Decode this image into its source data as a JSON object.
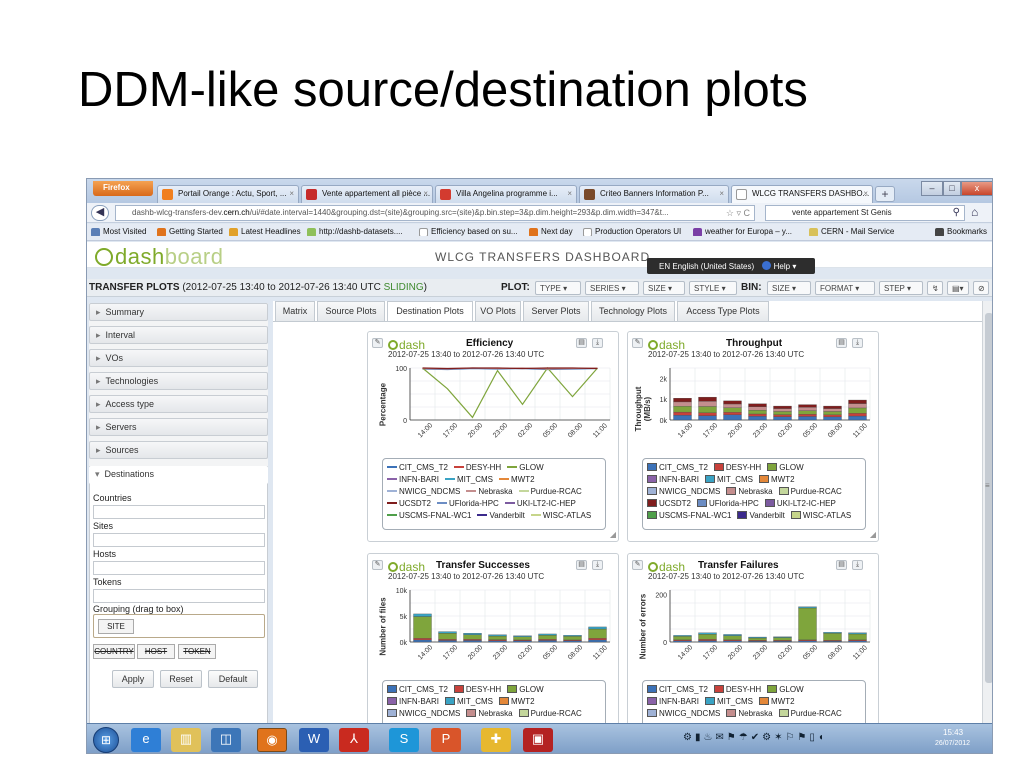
{
  "slide": {
    "title": "DDM-like source/destination plots"
  },
  "browser": {
    "menu_label": "Firefox",
    "tabs": [
      {
        "label": "Portail Orange : Actu, Sport, ...",
        "favicon": "#f07f1e"
      },
      {
        "label": "Vente appartement all pièce ...",
        "favicon": "#c62b2b"
      },
      {
        "label": "Villa Angelina programme i...",
        "favicon": "#d33b2f"
      },
      {
        "label": "Criteo Banners Information P...",
        "favicon": "#7a4a2a"
      },
      {
        "label": "WLCG TRANSFERS DASHBO...",
        "favicon": "#ffffff"
      }
    ],
    "url_prefix": "dashb-wlcg-transfers-dev.",
    "url_domain": "cern.ch",
    "url_rest": "/ui/#date.interval=1440&grouping.dst=(site)&grouping.src=(site)&p.bin.step=3&p.dim.height=293&p.dim.width=347&t...",
    "search_text": "vente appartement St Genis",
    "bookmarks": [
      {
        "label": "Most Visited",
        "color": "#5b7fb6"
      },
      {
        "label": "Getting Started",
        "color": "#e0731c"
      },
      {
        "label": "Latest Headlines",
        "color": "#e1a12a"
      },
      {
        "label": "http://dashb-datasets....",
        "color": "#8fc05a"
      },
      {
        "label": "Efficiency based on su...",
        "color": "#ffffff"
      },
      {
        "label": "Next day",
        "color": "#e0731c"
      },
      {
        "label": "Production Operators UI",
        "color": "#ffffff"
      },
      {
        "label": "weather for Europa – y...",
        "color": "#7a3fa6"
      },
      {
        "label": "CERN - Mail Service",
        "color": "#d8c15a"
      },
      {
        "label": "Bookmarks",
        "color": "#444444"
      }
    ]
  },
  "dashboard": {
    "logo_a": "dash",
    "logo_b": "board",
    "title": "WLCG TRANSFERS DASHBOARD",
    "language": "EN English (United States)",
    "help": "Help",
    "plot_bar": {
      "label": "TRANSFER PLOTS",
      "range": "(2012-07-25 13:40 to 2012-07-26 13:40 UTC",
      "sliding": "SLIDING",
      "range_end": ")",
      "plot_label": "PLOT:",
      "plot_selects": [
        "TYPE",
        "SERIES",
        "SIZE",
        "STYLE"
      ],
      "bin_label": "BIN:",
      "bin_selects": [
        "SIZE",
        "FORMAT",
        "STEP"
      ]
    },
    "sidebar": {
      "sections": [
        "Summary",
        "Interval",
        "VOs",
        "Technologies",
        "Access type",
        "Servers",
        "Sources"
      ],
      "open_section": "Destinations",
      "fields": [
        "Countries",
        "Sites",
        "Hosts",
        "Tokens"
      ],
      "grouping_label": "Grouping (drag to box)",
      "grouping_selected": "SITE",
      "grouping_options": [
        "COUNTRY",
        "HOST",
        "TOKEN"
      ],
      "buttons": [
        "Apply",
        "Reset",
        "Default"
      ]
    },
    "plot_tabs": [
      "Matrix",
      "Source Plots",
      "Destination Plots",
      "VO Plots",
      "Server Plots",
      "Technology Plots",
      "Access Type Plots"
    ],
    "active_tab": "Destination Plots",
    "subtitle": "2012-07-25 13:40 to 2012-07-26 13:40 UTC"
  },
  "legend_sites": [
    {
      "name": "CIT_CMS_T2",
      "color": "#3c72b8"
    },
    {
      "name": "DESY-HH",
      "color": "#c8413b"
    },
    {
      "name": "GLOW",
      "color": "#7fa53c"
    },
    {
      "name": "INFN-BARI",
      "color": "#8a62a8"
    },
    {
      "name": "MIT_CMS",
      "color": "#3aa3c4"
    },
    {
      "name": "MWT2",
      "color": "#e4883a"
    },
    {
      "name": "NWICG_NDCMS",
      "color": "#9fb2d6"
    },
    {
      "name": "Nebraska",
      "color": "#c48e8e"
    },
    {
      "name": "Purdue-RCAC",
      "color": "#c4d79c"
    },
    {
      "name": "UCSDT2",
      "color": "#7f1d1d"
    },
    {
      "name": "UFlorida-HPC",
      "color": "#6c8dc4"
    },
    {
      "name": "UKI-LT2-IC-HEP",
      "color": "#7c5ba0"
    },
    {
      "name": "USCMS-FNAL-WC1",
      "color": "#4f9f4a"
    },
    {
      "name": "Vanderbilt",
      "color": "#3b2a8c"
    },
    {
      "name": "WISC-ATLAS",
      "color": "#c6d58a"
    }
  ],
  "chart_data": [
    {
      "type": "line",
      "title": "Efficiency",
      "ylabel": "Percentage",
      "ylim": [
        0,
        100
      ],
      "yticks": [
        "0",
        "100"
      ],
      "x": [
        "14:00",
        "17:00",
        "20:00",
        "23:00",
        "02:00",
        "05:00",
        "08:00",
        "11:00"
      ],
      "series": [
        {
          "name": "CIT_CMS_T2",
          "values": [
            98,
            97,
            99,
            98,
            99,
            97,
            98,
            99
          ]
        },
        {
          "name": "GLOW",
          "values": [
            100,
            60,
            5,
            95,
            30,
            100,
            45,
            100
          ]
        },
        {
          "name": "Nebraska",
          "values": [
            99,
            98,
            100,
            99,
            100,
            98,
            99,
            100
          ]
        },
        {
          "name": "UCSDT2",
          "values": [
            100,
            99,
            100,
            100,
            99,
            100,
            100,
            99
          ]
        }
      ]
    },
    {
      "type": "bar",
      "title": "Throughput",
      "ylabel": "Throughput (MB/s)",
      "ylim": [
        0,
        2500
      ],
      "yticks": [
        "0k",
        "1k",
        "2k"
      ],
      "x": [
        "14:00",
        "17:00",
        "20:00",
        "23:00",
        "02:00",
        "05:00",
        "08:00",
        "11:00"
      ],
      "series": [
        {
          "name": "CIT_CMS_T2",
          "values": [
            230,
            210,
            250,
            180,
            160,
            170,
            150,
            190
          ]
        },
        {
          "name": "DESY-HH",
          "values": [
            150,
            140,
            120,
            110,
            100,
            110,
            100,
            130
          ]
        },
        {
          "name": "GLOW",
          "values": [
            280,
            300,
            220,
            180,
            150,
            170,
            160,
            260
          ]
        },
        {
          "name": "Nebraska",
          "values": [
            210,
            250,
            180,
            170,
            140,
            160,
            140,
            210
          ]
        },
        {
          "name": "UCSDT2",
          "values": [
            180,
            200,
            150,
            140,
            120,
            130,
            120,
            170
          ]
        }
      ]
    },
    {
      "type": "bar",
      "title": "Transfer Successes",
      "ylabel": "Number of files",
      "ylim": [
        0,
        10000
      ],
      "yticks": [
        "0k",
        "5k",
        "10k"
      ],
      "x": [
        "14:00",
        "17:00",
        "20:00",
        "23:00",
        "02:00",
        "05:00",
        "08:00",
        "11:00"
      ],
      "series": [
        {
          "name": "CIT_CMS_T2",
          "values": [
            400,
            300,
            300,
            250,
            250,
            300,
            250,
            400
          ]
        },
        {
          "name": "DESY-HH",
          "values": [
            300,
            200,
            200,
            200,
            150,
            200,
            150,
            300
          ]
        },
        {
          "name": "GLOW",
          "values": [
            4200,
            1200,
            900,
            700,
            600,
            800,
            700,
            1800
          ]
        },
        {
          "name": "MIT_CMS",
          "values": [
            500,
            300,
            300,
            250,
            200,
            250,
            200,
            400
          ]
        }
      ]
    },
    {
      "type": "bar",
      "title": "Transfer Failures",
      "ylabel": "Number of errors",
      "ylim": [
        0,
        220
      ],
      "yticks": [
        "0",
        "200"
      ],
      "x": [
        "14:00",
        "17:00",
        "20:00",
        "23:00",
        "02:00",
        "05:00",
        "08:00",
        "11:00"
      ],
      "series": [
        {
          "name": "CIT_CMS_T2",
          "values": [
            5,
            6,
            5,
            4,
            4,
            5,
            4,
            5
          ]
        },
        {
          "name": "DESY-HH",
          "values": [
            4,
            5,
            4,
            3,
            3,
            4,
            3,
            4
          ]
        },
        {
          "name": "GLOW",
          "values": [
            15,
            22,
            18,
            10,
            12,
            135,
            30,
            25
          ]
        },
        {
          "name": "MIT_CMS",
          "values": [
            4,
            6,
            5,
            4,
            3,
            5,
            4,
            5
          ]
        }
      ]
    }
  ],
  "taskbar": {
    "time": "15:43",
    "date": "26/07/2012"
  }
}
